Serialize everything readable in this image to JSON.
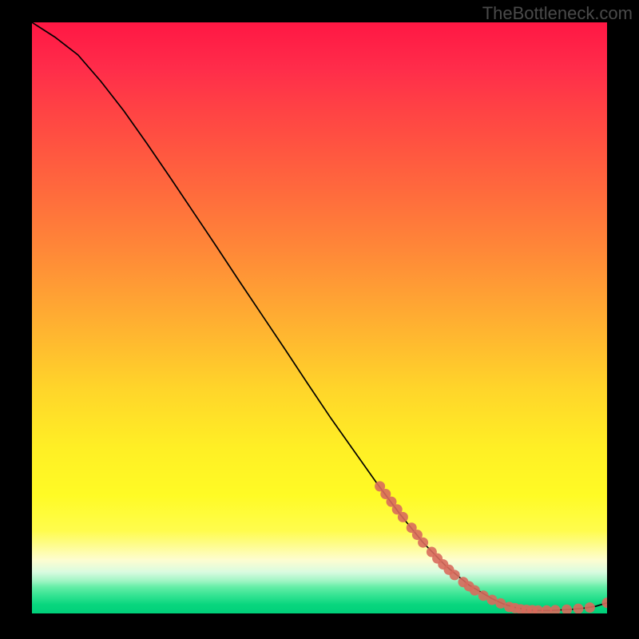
{
  "watermark": "TheBottleneck.com",
  "chart_data": {
    "type": "line",
    "title": "",
    "xlabel": "",
    "ylabel": "",
    "xlim": [
      0,
      100
    ],
    "ylim": [
      0,
      100
    ],
    "gradient": {
      "description": "vertical gradient red-orange-yellow-green representing bottleneck severity",
      "stops": [
        {
          "pos": 0,
          "color": "#ff1744"
        },
        {
          "pos": 50,
          "color": "#ffba2f"
        },
        {
          "pos": 80,
          "color": "#fffb25"
        },
        {
          "pos": 97,
          "color": "#33e392"
        },
        {
          "pos": 100,
          "color": "#00d07a"
        }
      ]
    },
    "series": [
      {
        "name": "bottleneck-curve",
        "x": [
          0,
          4,
          8,
          12,
          16,
          20,
          24,
          28,
          32,
          36,
          40,
          44,
          48,
          52,
          56,
          60,
          64,
          68,
          72,
          76,
          80,
          82,
          84,
          86,
          88,
          90,
          92,
          94,
          96,
          98,
          100
        ],
        "y": [
          100,
          97.5,
          94.5,
          90,
          85,
          79.5,
          73.8,
          68,
          62.2,
          56.3,
          50.5,
          44.7,
          38.8,
          33,
          27.5,
          22,
          16.8,
          12,
          8,
          4.8,
          2.5,
          1.6,
          1.0,
          0.6,
          0.5,
          0.5,
          0.6,
          0.7,
          0.9,
          1.2,
          1.8
        ]
      }
    ],
    "markers": {
      "name": "highlighted-points",
      "color": "#d86a5c",
      "points": [
        {
          "x": 60.5,
          "y": 21.5
        },
        {
          "x": 61.5,
          "y": 20.2
        },
        {
          "x": 62.5,
          "y": 18.9
        },
        {
          "x": 63.5,
          "y": 17.6
        },
        {
          "x": 64.5,
          "y": 16.3
        },
        {
          "x": 66.0,
          "y": 14.5
        },
        {
          "x": 67.0,
          "y": 13.3
        },
        {
          "x": 68.0,
          "y": 12.0
        },
        {
          "x": 69.5,
          "y": 10.4
        },
        {
          "x": 70.5,
          "y": 9.3
        },
        {
          "x": 71.5,
          "y": 8.3
        },
        {
          "x": 72.5,
          "y": 7.4
        },
        {
          "x": 73.5,
          "y": 6.5
        },
        {
          "x": 75.0,
          "y": 5.3
        },
        {
          "x": 76.0,
          "y": 4.6
        },
        {
          "x": 77.0,
          "y": 3.9
        },
        {
          "x": 78.5,
          "y": 3.0
        },
        {
          "x": 80.0,
          "y": 2.3
        },
        {
          "x": 81.5,
          "y": 1.7
        },
        {
          "x": 83.0,
          "y": 1.1
        },
        {
          "x": 84.0,
          "y": 0.9
        },
        {
          "x": 85.0,
          "y": 0.7
        },
        {
          "x": 86.0,
          "y": 0.6
        },
        {
          "x": 87.0,
          "y": 0.55
        },
        {
          "x": 88.0,
          "y": 0.5
        },
        {
          "x": 89.5,
          "y": 0.5
        },
        {
          "x": 91.0,
          "y": 0.55
        },
        {
          "x": 93.0,
          "y": 0.65
        },
        {
          "x": 95.0,
          "y": 0.8
        },
        {
          "x": 97.0,
          "y": 1.0
        },
        {
          "x": 100.0,
          "y": 1.8
        }
      ]
    }
  }
}
